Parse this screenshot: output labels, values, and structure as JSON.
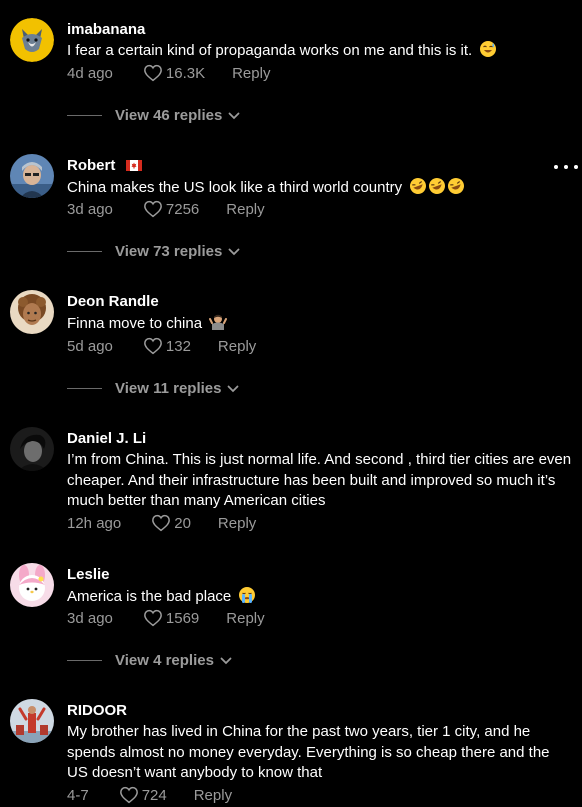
{
  "comments": [
    {
      "username": "imabanana",
      "text": "I fear a certain kind of propaganda works on me and this is it.",
      "time": "4d ago",
      "likes": "16.3K",
      "reply_label": "Reply",
      "view_replies": "View 46 replies"
    },
    {
      "username": "Robert",
      "text": "China makes the US look like a third world country",
      "time": "3d ago",
      "likes": "7256",
      "reply_label": "Reply",
      "view_replies": "View 73 replies"
    },
    {
      "username": "Deon Randle",
      "text": "Finna move to china",
      "time": "5d ago",
      "likes": "132",
      "reply_label": "Reply",
      "view_replies": "View 11 replies"
    },
    {
      "username": "Daniel J. Li",
      "text": "I’m from China. This is just normal life. And second , third tier cities are even cheaper. And their infrastructure has been built and improved so much it’s much better than many American cities",
      "time": "12h ago",
      "likes": "20",
      "reply_label": "Reply"
    },
    {
      "username": "Leslie",
      "text": "America is the bad place",
      "time": "3d ago",
      "likes": "1569",
      "reply_label": "Reply",
      "view_replies": "View 4 replies"
    },
    {
      "username": "RIDOOR",
      "text": "My brother has lived in China for the past two years, tier 1 city, and he spends almost no money everyday. Everything is so cheap there and the US doesn’t want anybody to know that",
      "time": "4-7",
      "likes": "724",
      "reply_label": "Reply"
    }
  ],
  "colors": {
    "background": "#000000",
    "text": "#ffffff",
    "secondary": "#9b9b9b"
  },
  "icons": {
    "like": "heart-outline-icon",
    "expand": "chevron-down-icon",
    "more": "more-horizontal-icon",
    "flag": "canada-flag-icon"
  }
}
